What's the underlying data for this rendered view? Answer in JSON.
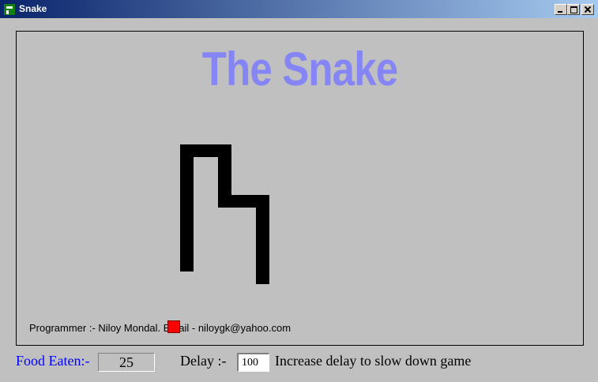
{
  "window": {
    "title": "Snake",
    "icon": "snake-app-icon",
    "controls": [
      "minimize-icon",
      "maximize-icon",
      "close-icon"
    ]
  },
  "game": {
    "title": "The Snake",
    "title_color": "#8585f5",
    "credits": "Programmer :- Niloy Mondal. Email - niloygk@yahoo.com",
    "snake_color": "#000000",
    "food_color": "#ff0000"
  },
  "controls": {
    "food_label": "Food Eaten:-",
    "food_count": "25",
    "delay_label": "Delay  :-",
    "delay_value": "100",
    "hint": "Increase delay to slow down game"
  }
}
